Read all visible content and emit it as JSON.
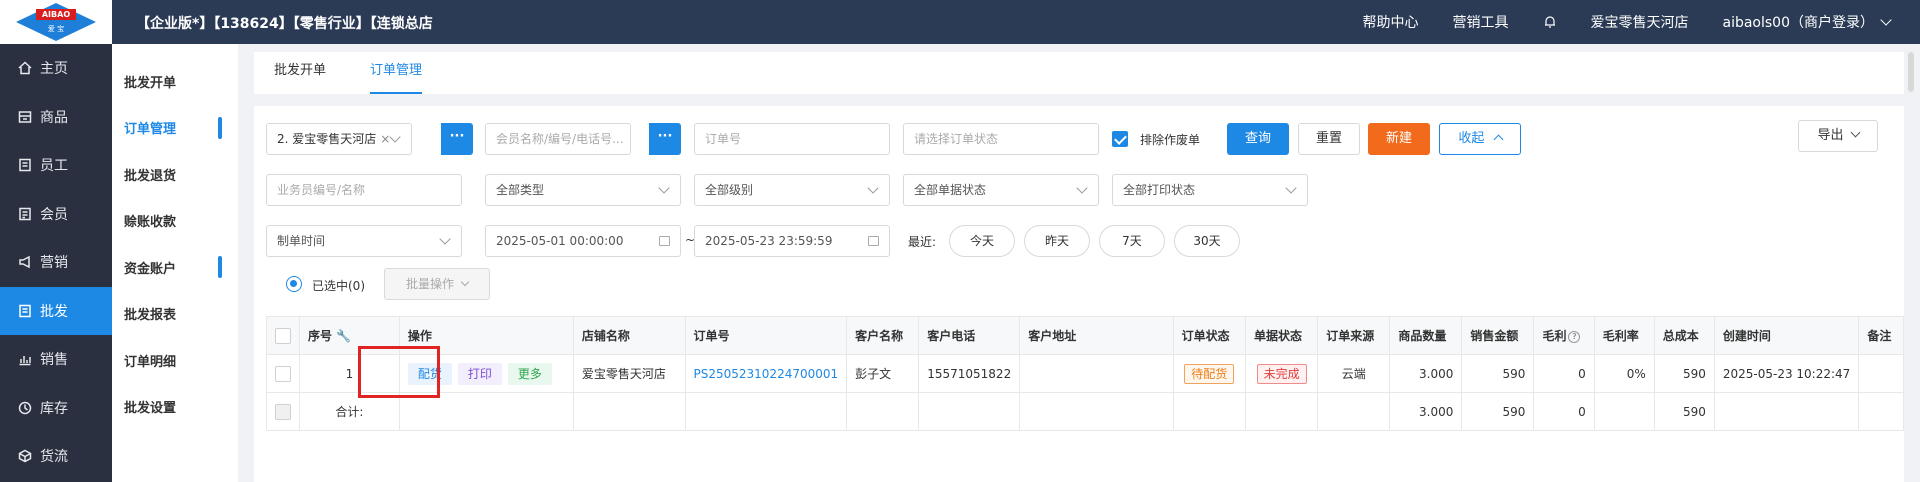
{
  "header": {
    "logo_text": "AIBAO",
    "logo_sub": "爱 宝",
    "title": "【企业版*】【138624】【零售行业】【连锁总店",
    "help": "帮助中心",
    "marketing": "营销工具",
    "store": "爱宝零售天河店",
    "user": "aibaols00（商户登录）"
  },
  "sidebar": {
    "items": [
      {
        "label": "主页",
        "icon": "home-icon"
      },
      {
        "label": "商品",
        "icon": "goods-icon"
      },
      {
        "label": "员工",
        "icon": "staff-icon"
      },
      {
        "label": "会员",
        "icon": "member-icon"
      },
      {
        "label": "营销",
        "icon": "megaphone-icon"
      },
      {
        "label": "批发",
        "icon": "wholesale-icon"
      },
      {
        "label": "销售",
        "icon": "chart-icon"
      },
      {
        "label": "库存",
        "icon": "inventory-icon"
      },
      {
        "label": "货流",
        "icon": "flow-icon"
      }
    ],
    "active": "批发"
  },
  "subnav": {
    "items": [
      "批发开单",
      "订单管理",
      "批发退货",
      "赊账收款",
      "资金账户",
      "批发报表",
      "订单明细",
      "批发设置"
    ],
    "active": "订单管理"
  },
  "tabs": [
    "批发开单",
    "订单管理"
  ],
  "filters": {
    "store_selected": "2. 爱宝零售天河店",
    "member_placeholder": "会员名称/编号/电话号...",
    "order_no_placeholder": "订单号",
    "order_status_placeholder": "请选择订单状态",
    "exclude_void": "排除作废单",
    "query": "查询",
    "reset": "重置",
    "new": "新建",
    "collapse": "收起",
    "export": "导出",
    "salesman_placeholder": "业务员编号/名称",
    "type": "全部类型",
    "level": "全部级别",
    "doc_status": "全部单据状态",
    "print_status": "全部打印状态",
    "time_type": "制单时间",
    "start_time": "2025-05-01 00:00:00",
    "tilde": "~",
    "end_time": "2025-05-23 23:59:59",
    "recent": "最近:",
    "quick": [
      "今天",
      "昨天",
      "7天",
      "30天"
    ],
    "selected": "已选中(0)",
    "batch": "批量操作"
  },
  "table": {
    "headers": [
      "序号",
      "操作",
      "店铺名称",
      "订单号",
      "客户名称",
      "客户电话",
      "客户地址",
      "订单状态",
      "单据状态",
      "订单来源",
      "商品数量",
      "销售金额",
      "毛利",
      "毛利率",
      "总成本",
      "创建时间",
      "备注"
    ],
    "row": {
      "index": "1",
      "ops": [
        "配货",
        "打印",
        "更多"
      ],
      "store": "爱宝零售天河店",
      "order_no": "PS25052310224700001",
      "customer": "彭子文",
      "phone": "15571051822",
      "address": "",
      "order_status": "待配货",
      "doc_status": "未完成",
      "source": "云端",
      "qty": "3.000",
      "amount": "590",
      "profit": "0",
      "margin": "0%",
      "cost": "590",
      "created": "2025-05-23 10:22:47",
      "note": ""
    },
    "total": {
      "label": "合计:",
      "qty": "3.000",
      "amount": "590",
      "profit": "0",
      "cost": "590"
    }
  }
}
